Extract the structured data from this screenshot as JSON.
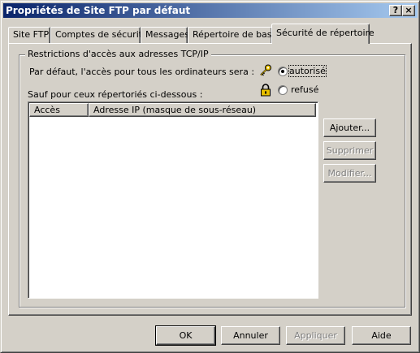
{
  "window": {
    "title": "Propriétés de Site FTP par défaut",
    "help_glyph": "?",
    "close_glyph": "×"
  },
  "tabs": [
    {
      "label": "Site FTP",
      "active": false
    },
    {
      "label": "Comptes de sécurité",
      "active": false
    },
    {
      "label": "Messages",
      "active": false
    },
    {
      "label": "Répertoire de base",
      "active": false
    },
    {
      "label": "Sécurité de répertoire",
      "active": true
    }
  ],
  "group": {
    "label": "Restrictions d'accès aux adresses TCP/IP",
    "default_text": "Par défaut, l'accès pour tous les ordinateurs sera :",
    "radio_granted": {
      "label": "autorisé",
      "checked": true,
      "icon": "key-icon"
    },
    "radio_denied": {
      "label": "refusé",
      "checked": false,
      "icon": "lock-icon"
    },
    "except_text": "Sauf pour  ceux répertoriés ci-dessous :",
    "columns": [
      "Accès",
      "Adresse IP (masque de sous-réseau)"
    ],
    "rows": [],
    "buttons": {
      "add": "Ajouter...",
      "remove": "Supprimer",
      "edit": "Modifier..."
    }
  },
  "footer": {
    "ok": "OK",
    "cancel": "Annuler",
    "apply": "Appliquer",
    "help": "Aide"
  },
  "colors": {
    "title_start": "#0a246a",
    "title_end": "#a6caf0",
    "face": "#d4d0c8"
  }
}
